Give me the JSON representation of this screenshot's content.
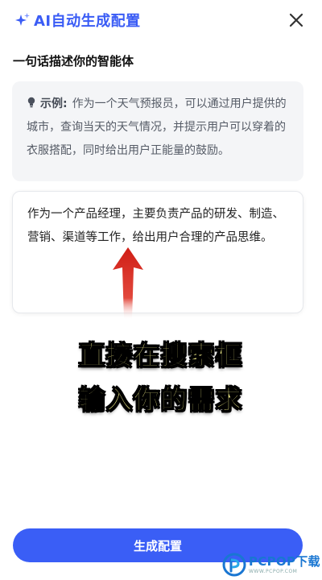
{
  "header": {
    "title": "AI自动生成配置",
    "sparkle_icon": "sparkle-icon",
    "close_icon": "close-icon"
  },
  "section": {
    "label": "一句话描述你的智能体"
  },
  "example": {
    "icon": "lightbulb-icon",
    "prefix": "示例:",
    "text": "作为一个天气预报员，可以通过用户提供的城市，查询当天的天气情况，并提示用户可以穿着的衣服搭配，同时给出用户正能量的鼓励。"
  },
  "input": {
    "value": "作为一个产品经理，主要负责产品的研发、制造、营销、渠道等工作，给出用户合理的产品思维。"
  },
  "overlay": {
    "line1": "直接在搜索框",
    "line2": "输入你的需求"
  },
  "actions": {
    "generate_label": "生成配置"
  },
  "watermark": {
    "text": "PCPOP下载",
    "sub": "WWW.PCPOP.COM"
  },
  "colors": {
    "accent": "#3a5ef6",
    "title": "#3a5cf5",
    "overlay_text": "#f6f28c",
    "arrow": "#d6281f"
  }
}
